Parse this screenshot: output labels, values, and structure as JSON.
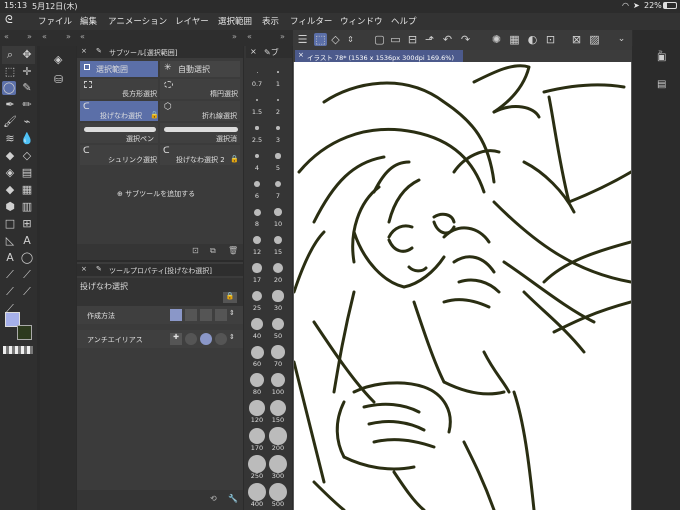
{
  "status_bar": {
    "time": "15:13",
    "date": "5月12日(木)",
    "battery": "22%"
  },
  "menu": {
    "items": [
      "ファイル",
      "編集",
      "アニメーション",
      "レイヤー",
      "選択範囲",
      "表示",
      "フィルター",
      "ウィンドウ",
      "ヘルプ"
    ]
  },
  "subtool_panel": {
    "title": "サブツール[選択範囲]",
    "tab_left": "選択範囲",
    "tab_right": "自動選択",
    "items": [
      {
        "label": "長方形選択"
      },
      {
        "label": "楕円選択"
      },
      {
        "label": "投げなわ選択"
      },
      {
        "label": "折れ線選択"
      },
      {
        "label": "選択ペン"
      },
      {
        "label": "選択消し"
      },
      {
        "label": "シュリンク選択"
      },
      {
        "label": "投げなわ選択 2"
      }
    ],
    "add_label": "サブツールを追加する"
  },
  "tool_property": {
    "title": "ツールプロパティ[投げなわ選択]",
    "tool_name": "投げなわ選択",
    "rows": [
      {
        "label": "作成方法"
      },
      {
        "label": "アンチエイリアス"
      }
    ]
  },
  "brush_sizes": [
    "0.7",
    "1",
    "1.5",
    "2",
    "2.5",
    "3",
    "4",
    "5",
    "6",
    "7",
    "8",
    "10",
    "12",
    "15",
    "17",
    "20",
    "25",
    "30",
    "40",
    "50",
    "60",
    "70",
    "80",
    "100",
    "120",
    "150",
    "170",
    "200",
    "250",
    "300",
    "400",
    "500"
  ],
  "canvas": {
    "tab_label": "イラスト 78* (1536 x 1536px 300dpi 169.6%)"
  },
  "colors": {
    "accent": "#5b6fa8",
    "line_art": "#2a2e12",
    "main_color": "#a6b0ea",
    "sub_color": "#2d3a1e"
  }
}
